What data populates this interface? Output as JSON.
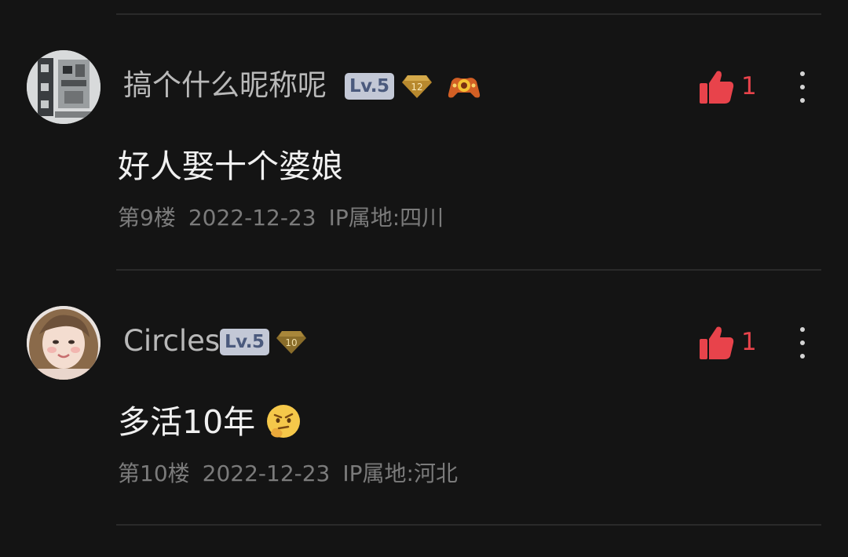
{
  "comments": [
    {
      "username": "搞个什么昵称呢",
      "level": "Lv.5",
      "gem_level": "12",
      "has_game_icon": true,
      "likes": "1",
      "content": "好人娶十个婆娘",
      "floor": "第9楼",
      "date": "2022-12-23",
      "ip": "IP属地:四川",
      "colors": {
        "gem": "#b8892e",
        "like": "#e8434b"
      }
    },
    {
      "username": "Circles",
      "level": "Lv.5",
      "gem_level": "10",
      "has_game_icon": false,
      "likes": "1",
      "content": "多活10年",
      "emoji": "thinking-face-emoji",
      "floor": "第10楼",
      "date": "2022-12-23",
      "ip": "IP属地:河北",
      "colors": {
        "gem": "#8a6d2a",
        "like": "#e8434b"
      }
    }
  ]
}
